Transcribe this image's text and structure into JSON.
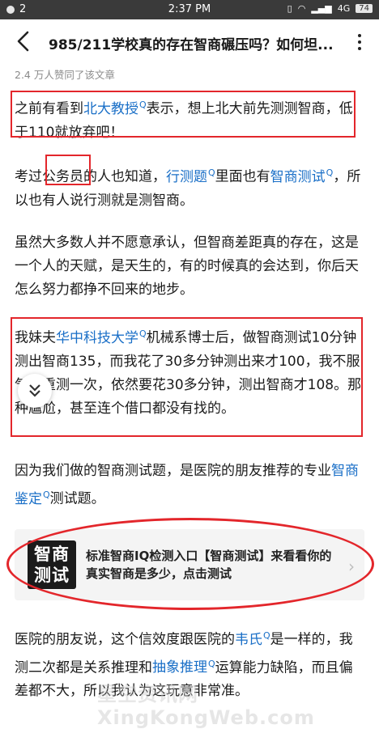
{
  "status": {
    "time": "2:37 PM",
    "left_indicator": "2",
    "signal_label": "4G",
    "battery": "74"
  },
  "header": {
    "title": "985/211学校真的存在智商碾压吗？如何坦..."
  },
  "meta": {
    "likes": "2.4 万人赞同了该文章"
  },
  "paragraphs": {
    "p1": {
      "t1": "之前有看到",
      "k1": "北大教授",
      "t2": "表示，想上北大前先测测智商，低于110就放弃吧！"
    },
    "p2": {
      "t1": "考过公务员的人也知道，",
      "k1": "行测题",
      "t2": "里面也有",
      "k2": "智商测试",
      "t3": "，所以也有人说行测就是测智商。"
    },
    "p3": {
      "t1": "虽然大多数人并不愿意承认，但智商差距真的存在，这是一个人的天赋，是天生的，有的时候真的会达到，你后天怎么努力都挣不回来的地步。"
    },
    "p4": {
      "t1": "我妹夫",
      "k1": "华中科技大学",
      "t2": "机械系博士后，做智商测试10分钟测出智商135，而我花了30多分钟测出来才100，我不服气又重测一次，依然要花30多分钟，测出智商才108。那种尴尬，甚至连个借口都没有找的。"
    },
    "p5": {
      "t1": "因为我们做的智商测试题，是医院的朋友推荐的专业",
      "k1": "智商鉴定",
      "t2": "测试题。"
    },
    "p6": {
      "t1": "医院的朋友说，这个信效度跟医院的",
      "k1": "韦氏",
      "t2": "是一样的，我测二次都是关系推理和",
      "k2": "抽象推理",
      "t3": "运算能力缺陷，而且偏差都不大，所以我认为这玩意非常准。"
    }
  },
  "ad": {
    "thumb_line1": "智商",
    "thumb_line2": "测试",
    "text": "标准智商IQ检测入口【智商测试】来看看你的真实智商是多少，点击测试"
  },
  "search_glyph": "Q",
  "watermark": "星空资讯网 XingKongWeb.com"
}
